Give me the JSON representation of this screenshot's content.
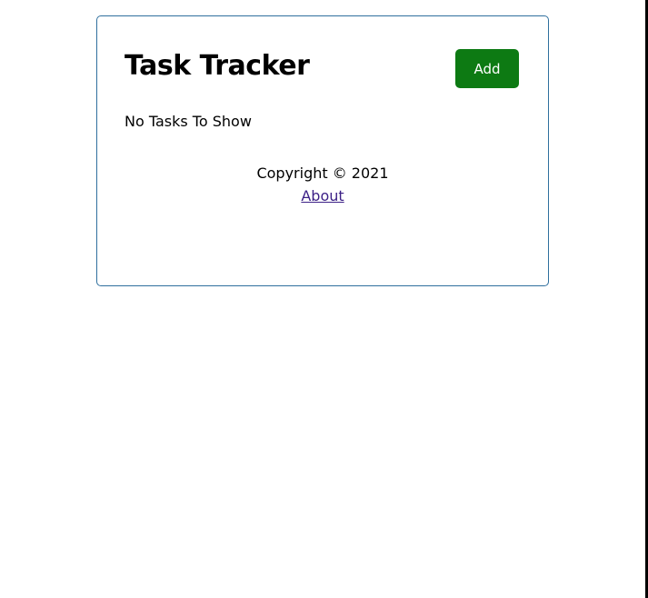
{
  "header": {
    "title": "Task Tracker",
    "add_button_label": "Add"
  },
  "tasks": {
    "empty_message": "No Tasks To Show"
  },
  "footer": {
    "copyright": "Copyright © 2021",
    "about_link": "About"
  },
  "colors": {
    "add_button_bg": "#0d7a13",
    "container_border": "#2f6f9e",
    "link": "#3b1f86"
  }
}
